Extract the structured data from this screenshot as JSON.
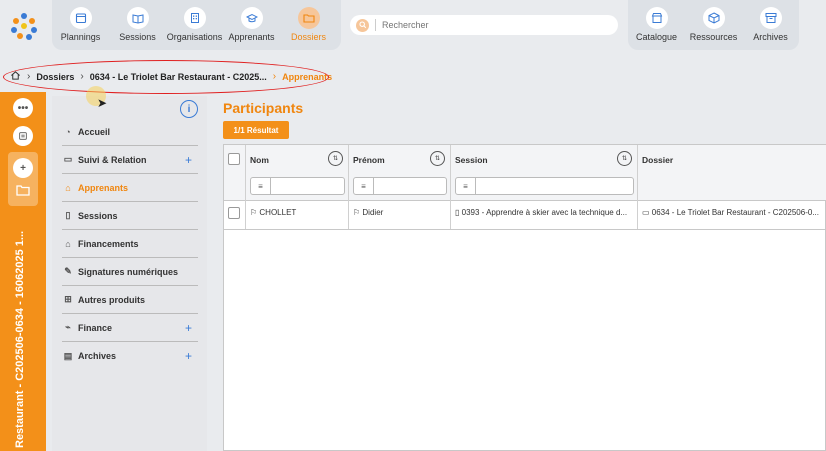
{
  "nav": {
    "items": [
      {
        "label": "Plannings",
        "icon": "calendar-icon"
      },
      {
        "label": "Sessions",
        "icon": "book-icon"
      },
      {
        "label": "Organisations",
        "icon": "building-icon"
      },
      {
        "label": "Apprenants",
        "icon": "graduation-cap-icon"
      },
      {
        "label": "Dossiers",
        "icon": "folder-icon",
        "active": true
      }
    ],
    "right_items": [
      {
        "label": "Catalogue",
        "icon": "store-icon"
      },
      {
        "label": "Ressources",
        "icon": "cube-icon"
      },
      {
        "label": "Archives",
        "icon": "archive-icon"
      }
    ]
  },
  "search": {
    "placeholder": "Rechercher"
  },
  "breadcrumb": {
    "items": [
      "Dossiers",
      "0634 - Le Triolet Bar Restaurant - C2025...",
      "Apprenants"
    ]
  },
  "left_strip": {
    "vertical_text": "Restaurant - C202506-0634 - 16062025 1..."
  },
  "sidebar": {
    "items": [
      {
        "label": "Accueil",
        "icon": "dashboard-icon",
        "plus": false
      },
      {
        "label": "Suivi & Relation",
        "icon": "chat-icon",
        "plus": true
      },
      {
        "label": "Apprenants",
        "icon": "graduation-cap-icon",
        "plus": false,
        "active": true
      },
      {
        "label": "Sessions",
        "icon": "book-icon",
        "plus": false
      },
      {
        "label": "Financements",
        "icon": "bank-icon",
        "plus": false
      },
      {
        "label": "Signatures numériques",
        "icon": "signature-icon",
        "plus": false
      },
      {
        "label": "Autres produits",
        "icon": "cart-icon",
        "plus": false
      },
      {
        "label": "Finance",
        "icon": "chart-icon",
        "plus": true
      },
      {
        "label": "Archives",
        "icon": "archive-icon",
        "plus": true
      }
    ]
  },
  "main": {
    "title": "Participants",
    "result_badge": "1/1 Résultat",
    "columns": [
      "Nom",
      "Prénom",
      "Session",
      "Dossier"
    ],
    "rows": [
      {
        "nom": "CHOLLET",
        "prenom": "Didier",
        "session": "0393 - Apprendre à skier avec la technique d...",
        "dossier": "0634 - Le Triolet Bar Restaurant - C202506-0..."
      }
    ]
  },
  "colors": {
    "accent": "#f39019",
    "accent_text": "#f0860f",
    "link": "#3a7bd5"
  }
}
